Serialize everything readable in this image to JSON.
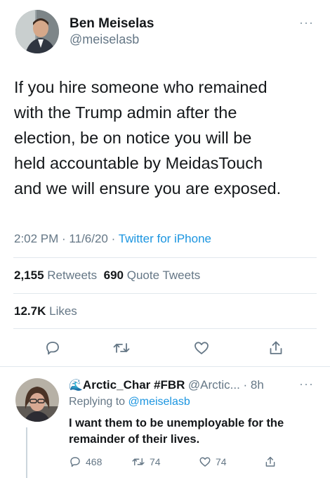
{
  "tweet": {
    "author_name": "Ben Meiselas",
    "author_handle": "@meiselasb",
    "text": "If you hire someone who remained\nwith the Trump admin after the\nelection, be on notice you will be\nheld accountable by MeidasTouch\nand we will ensure you are exposed.",
    "time": "2:02 PM",
    "date": "11/6/20",
    "source": "Twitter for iPhone",
    "retweets_count": "2,155",
    "retweets_label": "Retweets",
    "quote_count": "690",
    "quote_label": "Quote Tweets",
    "likes_count": "12.7K",
    "likes_label": "Likes"
  },
  "reply": {
    "author_name": "Arctic_Char #FBR",
    "author_emoji": "🌊",
    "author_handle": "@Arctic...",
    "age": "8h",
    "replying_prefix": "Replying to",
    "replying_to": "@meiselasb",
    "text": "I want them to be unemployable for the\nremainder of their lives.",
    "reply_count": "468",
    "retweet_count": "74",
    "like_count": "74"
  },
  "icons": {
    "more": "more-horizontal-icon",
    "reply": "reply-bubble-icon",
    "retweet": "retweet-icon",
    "like": "heart-icon",
    "share": "share-icon"
  },
  "colors": {
    "link": "#1b95e0",
    "secondary_text": "#657786",
    "divider": "#e1e8ed"
  }
}
